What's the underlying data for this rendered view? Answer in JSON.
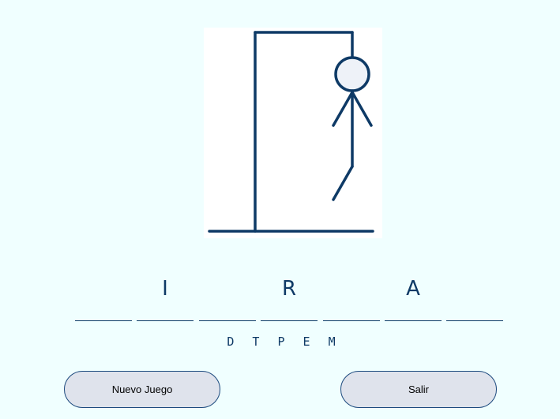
{
  "game": {
    "word_slots": [
      "",
      "I",
      "",
      "R",
      "",
      "A",
      ""
    ],
    "wrong_letters": [
      "D",
      "T",
      "P",
      "E",
      "M"
    ],
    "mistakes_shown": 5
  },
  "buttons": {
    "new_game": "Nuevo Juego",
    "exit": "Salir"
  },
  "colors": {
    "background": "#f0ffff",
    "ink": "#0e3a66",
    "button_fill": "#dfe3ec",
    "head_fill": "#eef2f8"
  }
}
